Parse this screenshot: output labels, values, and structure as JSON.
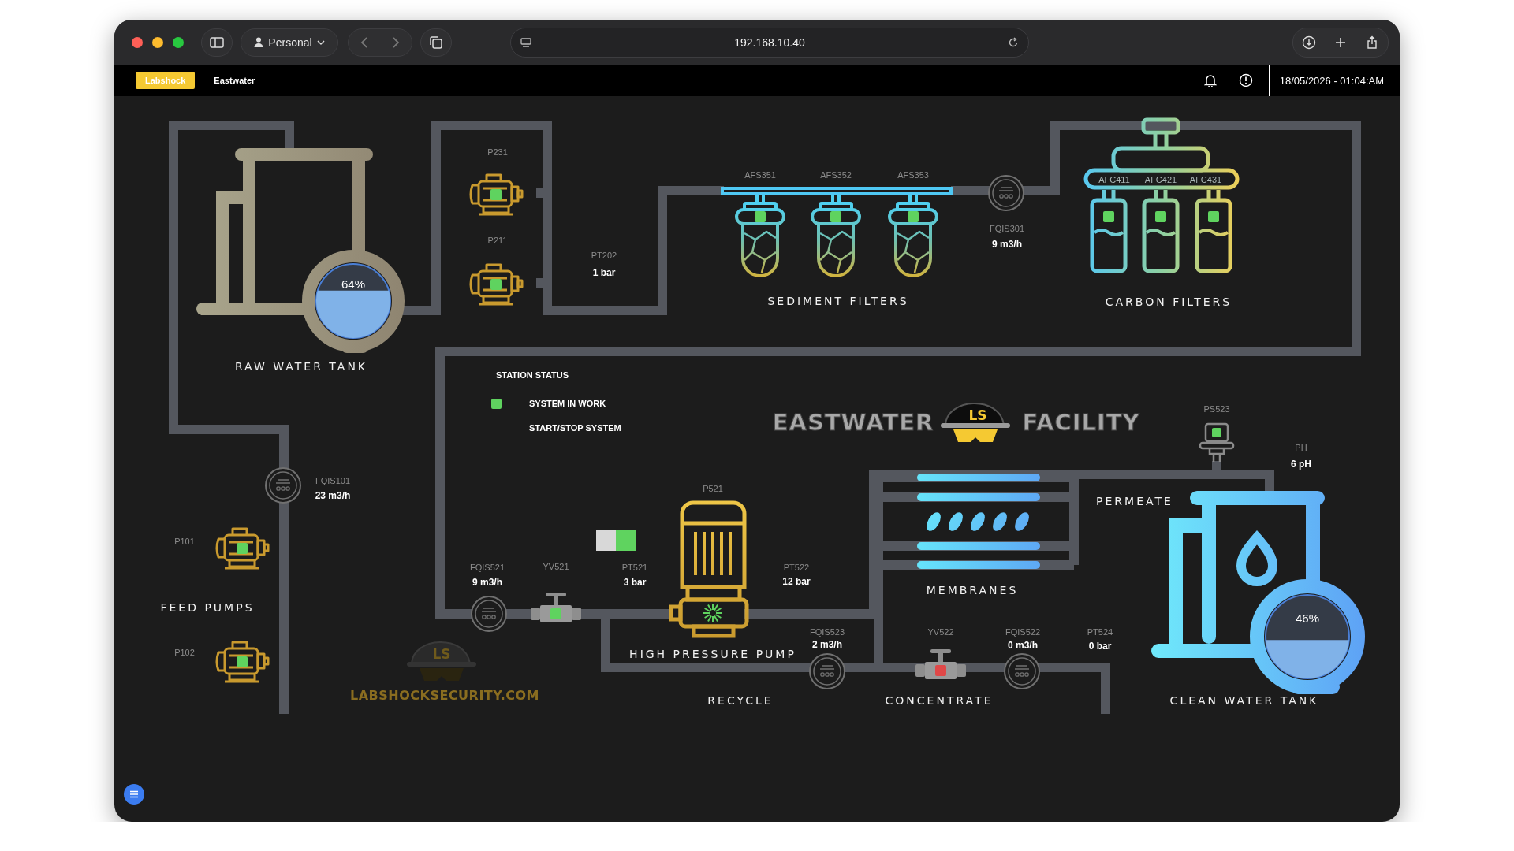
{
  "browser": {
    "profile": "Personal",
    "address": "192.168.10.40"
  },
  "header": {
    "tabs": [
      {
        "label": "Labshock",
        "selected": true
      },
      {
        "label": "Eastwater",
        "selected": false
      }
    ],
    "datetime": "18/05/2026 - 01:04:AM"
  },
  "title": {
    "left": "EASTWATER",
    "logo_text": "LS",
    "right": "FACILITY"
  },
  "raw_water_tank": {
    "label": "RAW WATER TANK",
    "reading": "64%"
  },
  "transfer_pumps": [
    {
      "tag": "P231",
      "running": true
    },
    {
      "tag": "P211",
      "running": true
    }
  ],
  "sediment_filters": {
    "label": "SEDIMENT FILTERS",
    "filters": [
      {
        "tag": "AFS351",
        "running": true
      },
      {
        "tag": "AFS352",
        "running": true
      },
      {
        "tag": "AFS353",
        "running": true
      }
    ]
  },
  "carbon_filters": {
    "label": "CARBON FILTERS",
    "filters": [
      {
        "tag": "AFC411",
        "running": true
      },
      {
        "tag": "AFC421",
        "running": true
      },
      {
        "tag": "AFC431",
        "running": true
      }
    ]
  },
  "feed_pumps": {
    "label": "FEED PUMPS",
    "pumps": [
      {
        "tag": "P101",
        "running": true
      },
      {
        "tag": "P102",
        "running": true
      }
    ]
  },
  "station_status": {
    "title": "STATION STATUS",
    "items": [
      {
        "kind": "indicator",
        "label": "SYSTEM IN WORK",
        "on": true
      },
      {
        "kind": "switch",
        "label": "START/STOP SYSTEM",
        "on": true
      }
    ]
  },
  "high_pressure_pump": {
    "label": "HIGH PRESSURE PUMP",
    "tag": "P521",
    "running": true
  },
  "instruments": [
    {
      "kind": "flow",
      "tag": "FQIS101",
      "reading": "23 m3/h"
    },
    {
      "kind": "pressure",
      "tag": "PT202",
      "reading": "1 bar"
    },
    {
      "kind": "flow",
      "tag": "FQIS301",
      "reading": "9 m3/h"
    },
    {
      "kind": "flow",
      "tag": "FQIS521",
      "reading": "9 m3/h"
    },
    {
      "kind": "pressure",
      "tag": "PT521",
      "reading": "3 bar"
    },
    {
      "kind": "pressure",
      "tag": "PT522",
      "reading": "12 bar"
    },
    {
      "kind": "flow",
      "tag": "FQIS523",
      "reading": "2 m3/h"
    },
    {
      "kind": "flow",
      "tag": "FQIS522",
      "reading": "0 m3/h"
    },
    {
      "kind": "pressure",
      "tag": "PT524",
      "reading": "0 bar"
    },
    {
      "kind": "analyzer",
      "tag": "PH",
      "reading": "6 pH"
    }
  ],
  "valves": [
    {
      "tag": "YV521",
      "open": true
    },
    {
      "tag": "YV522",
      "open": false
    }
  ],
  "pressure_switch": {
    "tag": "PS523",
    "on": true
  },
  "membranes": {
    "label": "MEMBRANES"
  },
  "line_labels": [
    "RECYCLE",
    "CONCENTRATE",
    "PERMEATE"
  ],
  "clean_water_tank": {
    "label": "CLEAN WATER TANK",
    "reading": "46%"
  },
  "brand": {
    "logo_text": "LS",
    "text": "LABSHOCKSECURITY.COM"
  }
}
